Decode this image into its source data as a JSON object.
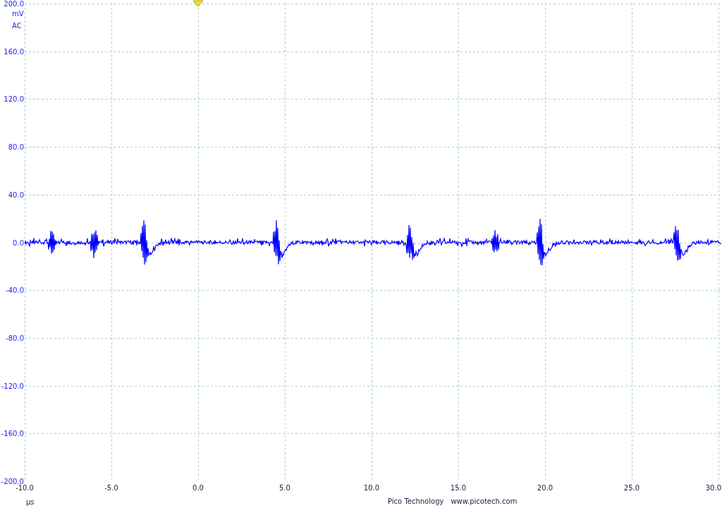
{
  "y_axis": {
    "labels": [
      "200.0",
      "160.0",
      "120.0",
      "80.0",
      "40.0",
      "0.0",
      "-40.0",
      "-80.0",
      "-120.0",
      "-160.0",
      "-200.0"
    ],
    "unit": "mV",
    "coupling": "AC"
  },
  "x_axis": {
    "labels": [
      "-10.0",
      "-5.0",
      "0.0",
      "5.0",
      "10.0",
      "15.0",
      "20.0",
      "25.0",
      "30.0"
    ],
    "unit": "µs"
  },
  "footer": {
    "brand": "Pico Technology",
    "website": "www.picotech.com"
  }
}
